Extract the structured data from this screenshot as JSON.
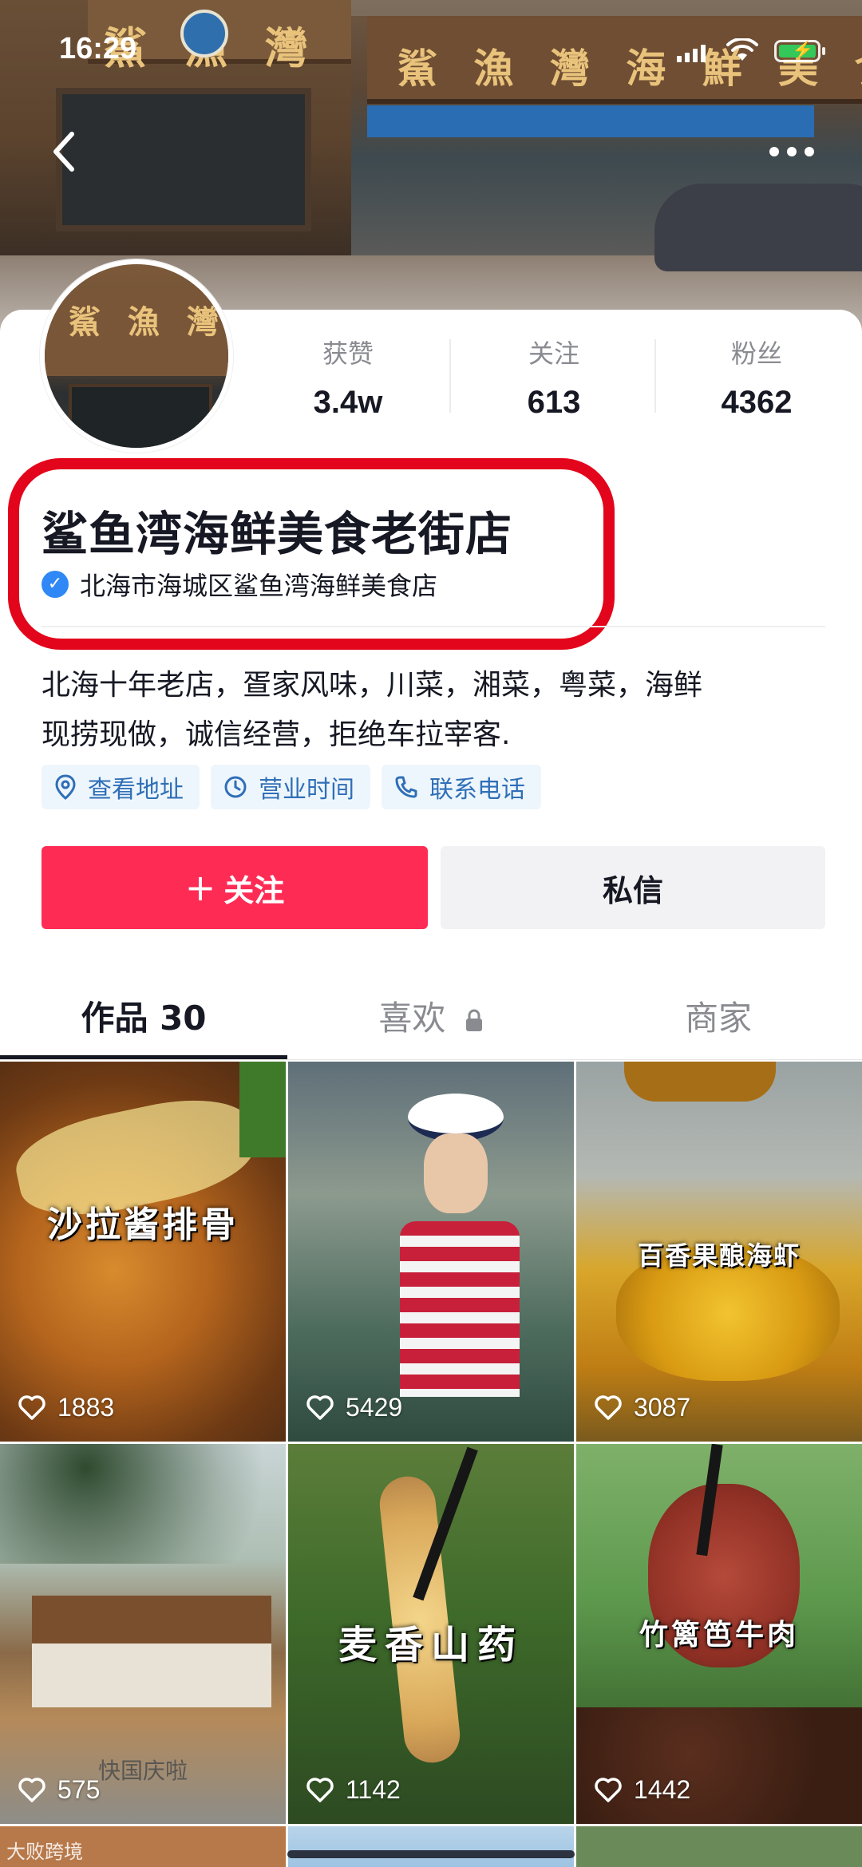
{
  "status_bar": {
    "time": "16:29"
  },
  "banner": {
    "sign_left": "鯊 漁 灣",
    "sign_right": "鯊 漁 灣 海 鮮 美 食"
  },
  "stats": [
    {
      "label": "获赞",
      "value": "3.4w"
    },
    {
      "label": "关注",
      "value": "613"
    },
    {
      "label": "粉丝",
      "value": "4362"
    }
  ],
  "profile": {
    "name": "鲨鱼湾海鲜美食老街店",
    "verified_label": "北海市海城区鲨鱼湾海鲜美食店",
    "bio_line1": "北海十年老店，疍家风味，川菜，湘菜，粤菜，海鲜",
    "bio_line2": "现捞现做，诚信经营，拒绝车拉宰客."
  },
  "chips": [
    {
      "label": "查看地址",
      "icon": "location-icon"
    },
    {
      "label": "营业时间",
      "icon": "clock-icon"
    },
    {
      "label": "联系电话",
      "icon": "phone-icon"
    }
  ],
  "actions": {
    "follow": "关注",
    "message": "私信"
  },
  "tabs": [
    {
      "label": "作品 30"
    },
    {
      "label": "喜欢"
    },
    {
      "label": "商家"
    }
  ],
  "videos": [
    {
      "caption": "沙拉酱排骨",
      "likes": "1883"
    },
    {
      "caption": "",
      "likes": "5429"
    },
    {
      "caption": "百香果酿海虾",
      "likes": "3087"
    },
    {
      "caption": "快国庆啦",
      "likes": "575"
    },
    {
      "caption": "麦香山药",
      "likes": "1142"
    },
    {
      "caption": "竹篱笆牛肉",
      "likes": "1442"
    }
  ],
  "watermark": "大败跨境",
  "colors": {
    "accent": "#fe2c55",
    "highlight_box": "#e3051b",
    "verify_blue": "#2f88f5",
    "chip_text": "#2f6fb7"
  }
}
